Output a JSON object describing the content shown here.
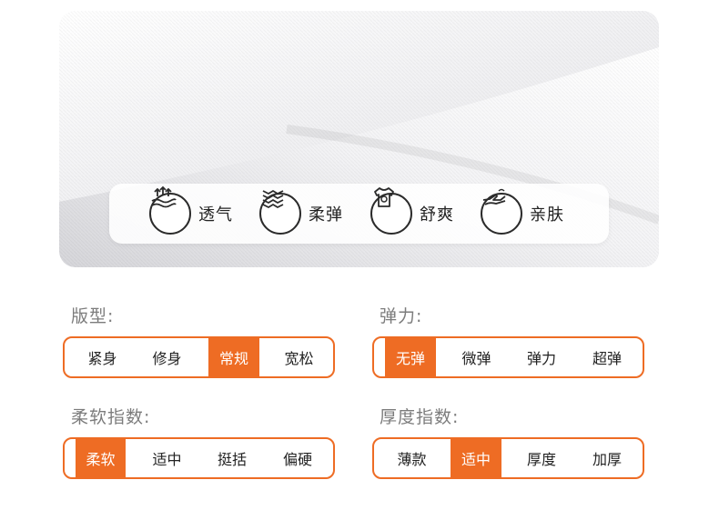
{
  "features": [
    {
      "icon": "breathable-icon",
      "label": "透气"
    },
    {
      "icon": "wave-stretch-icon",
      "label": "柔弹"
    },
    {
      "icon": "shirt-icon",
      "label": "舒爽"
    },
    {
      "icon": "hand-icon",
      "label": "亲肤"
    }
  ],
  "groups": [
    {
      "title": "版型:",
      "options": [
        "紧身",
        "修身",
        "常规",
        "宽松"
      ],
      "selected_index": 2
    },
    {
      "title": "弹力:",
      "options": [
        "无弹",
        "微弹",
        "弹力",
        "超弹"
      ],
      "selected_index": 0
    },
    {
      "title": "柔软指数:",
      "options": [
        "柔软",
        "适中",
        "挺括",
        "偏硬"
      ],
      "selected_index": 0
    },
    {
      "title": "厚度指数:",
      "options": [
        "薄款",
        "适中",
        "厚度",
        "加厚"
      ],
      "selected_index": 1
    }
  ],
  "colors": {
    "accent": "#ee6c24",
    "text": "#222222",
    "title": "#7c7c7c"
  }
}
